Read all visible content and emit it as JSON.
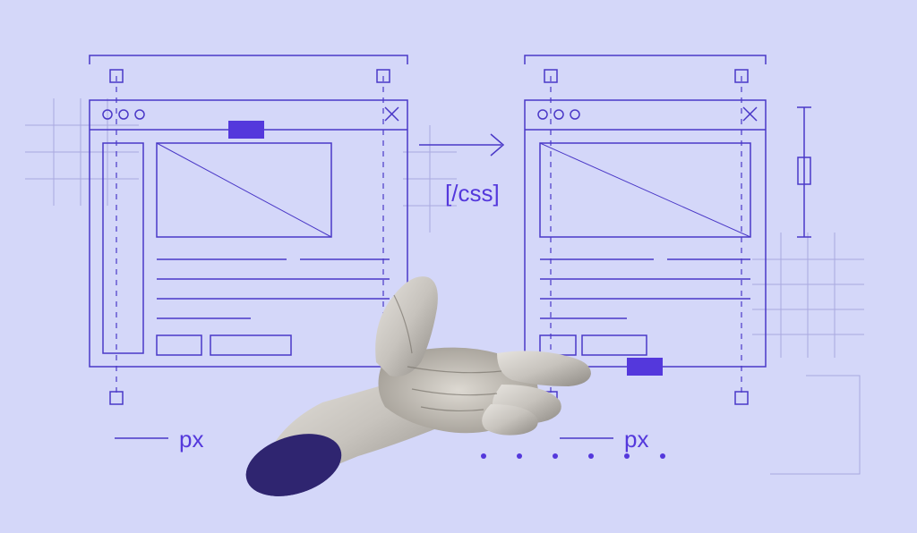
{
  "colors": {
    "background": "#d4d7f9",
    "stroke": "#4a38c7",
    "stroke_light": "#a9a9e0",
    "accent_fill": "#5438dc"
  },
  "labels": {
    "css_tag": "[/css]",
    "unit_left": "px",
    "unit_right": "px"
  },
  "icons": {
    "window_dots": "window-controls",
    "close": "close-icon",
    "arrow": "arrow-right",
    "hand": "hand-gesture"
  },
  "diagram": {
    "left_window": {
      "has_titlebar_dots": 3,
      "has_close": true,
      "active_tab": true,
      "sidebar": true,
      "image_placeholder": true,
      "text_lines": 4,
      "buttons": 2
    },
    "right_window": {
      "has_titlebar_dots": 3,
      "has_close": true,
      "image_placeholder": true,
      "text_lines": 4,
      "buttons": 2
    },
    "arrow_between": true,
    "dotted_row_count": 6
  }
}
